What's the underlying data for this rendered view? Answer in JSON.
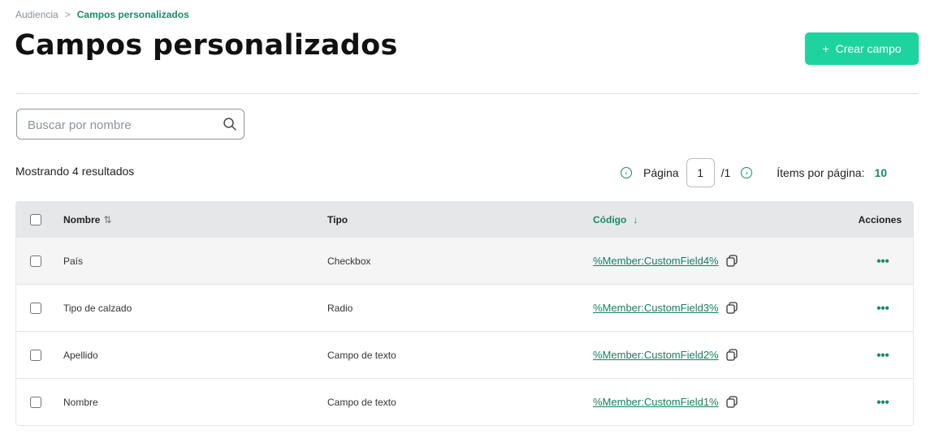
{
  "breadcrumb": {
    "parent": "Audiencia",
    "separator": ">",
    "current": "Campos personalizados"
  },
  "page": {
    "title": "Campos personalizados"
  },
  "actions": {
    "create_label": "Crear campo",
    "create_icon": "plus-icon"
  },
  "search": {
    "placeholder": "Buscar por nombre",
    "value": ""
  },
  "results_text": "Mostrando 4 resultados",
  "pagination": {
    "label": "Página",
    "current": "1",
    "total": "/1",
    "items_label": "Ítems por página:",
    "items_value": "10"
  },
  "table": {
    "headers": {
      "name": "Nombre",
      "type": "Tipo",
      "code": "Código",
      "actions": "Acciones"
    },
    "rows": [
      {
        "name": "País",
        "type": "Checkbox",
        "code": "%Member:CustomField4%"
      },
      {
        "name": "Tipo de calzado",
        "type": "Radio",
        "code": "%Member:CustomField3%"
      },
      {
        "name": "Apellido",
        "type": "Campo de texto",
        "code": "%Member:CustomField2%"
      },
      {
        "name": "Nombre",
        "type": "Campo de texto",
        "code": "%Member:CustomField1%"
      }
    ]
  },
  "colors": {
    "accent": "#1fd39f",
    "link": "#15805f",
    "header_bg": "#e6e7e9"
  }
}
